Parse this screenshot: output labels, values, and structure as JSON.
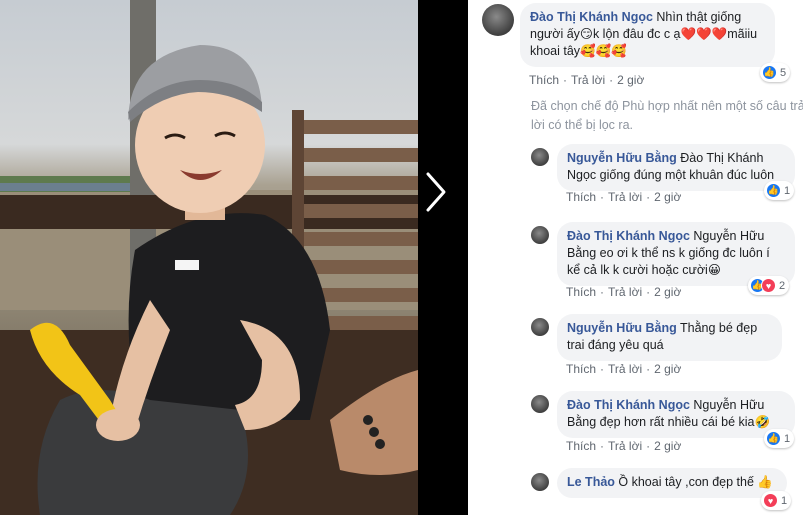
{
  "viewer": {
    "photo_alt": "Photo of a smiling boy in a grey cap holding a yellow toy on a boat",
    "next_icon": "chevron-right-icon"
  },
  "comments": [
    {
      "author": "Đào Thị Khánh Ngọc",
      "text_parts": [
        "Nhìn thật giống người ấy",
        "😏",
        "k lộn đâu đc c ạ",
        "❤️❤️❤️",
        "mãiiu khoai tây",
        "🥰🥰🥰"
      ],
      "actions": {
        "like": "Thích",
        "reply": "Trả lời",
        "time": "2 giờ"
      },
      "reactions": {
        "types": [
          "like"
        ],
        "count": "5"
      }
    },
    {
      "author": "Nguyễn Hữu Bằng",
      "text": "Đào Thị Khánh Ngọc giống đúng một khuân đúc luôn",
      "actions": {
        "like": "Thích",
        "reply": "Trả lời",
        "time": "2 giờ"
      },
      "reactions": {
        "types": [
          "like"
        ],
        "count": "1"
      }
    },
    {
      "author": "Đào Thị Khánh Ngọc",
      "text_parts": [
        "Nguyễn Hữu Bằng eo ơi k thể ns k giống đc luôn í kể cả lk k cười hoặc cười",
        "😀"
      ],
      "actions": {
        "like": "Thích",
        "reply": "Trả lời",
        "time": "2 giờ"
      },
      "reactions": {
        "types": [
          "like",
          "love"
        ],
        "count": "2"
      }
    },
    {
      "author": "Nguyễn Hữu Bằng",
      "text": "Thằng bé đẹp trai đáng yêu quá",
      "actions": {
        "like": "Thích",
        "reply": "Trả lời",
        "time": "2 giờ"
      }
    },
    {
      "author": "Đào Thị Khánh Ngọc",
      "text_parts": [
        "Nguyễn Hữu Bằng đẹp hơn rất nhiều cái bé kia",
        "🤣"
      ],
      "actions": {
        "like": "Thích",
        "reply": "Trả lời",
        "time": "2 giờ"
      },
      "reactions": {
        "types": [
          "like"
        ],
        "count": "1"
      }
    },
    {
      "author": "Le Thảo",
      "text_parts": [
        "Ồ khoai tây ,con đẹp thế",
        "👍"
      ],
      "actions": {
        "like": "Thích",
        "reply": "Trả lời",
        "time": "2 giờ"
      },
      "reactions": {
        "types": [
          "love"
        ],
        "count": "1"
      }
    }
  ],
  "filter_notice": "Đã chọn chế độ Phù hợp nhất nên một số câu trả lời có thể bị lọc ra.",
  "colors": {
    "author": "#385898",
    "bubble": "#f2f3f5",
    "like": "#1877f2",
    "love": "#f33e58",
    "muted": "#606770"
  }
}
